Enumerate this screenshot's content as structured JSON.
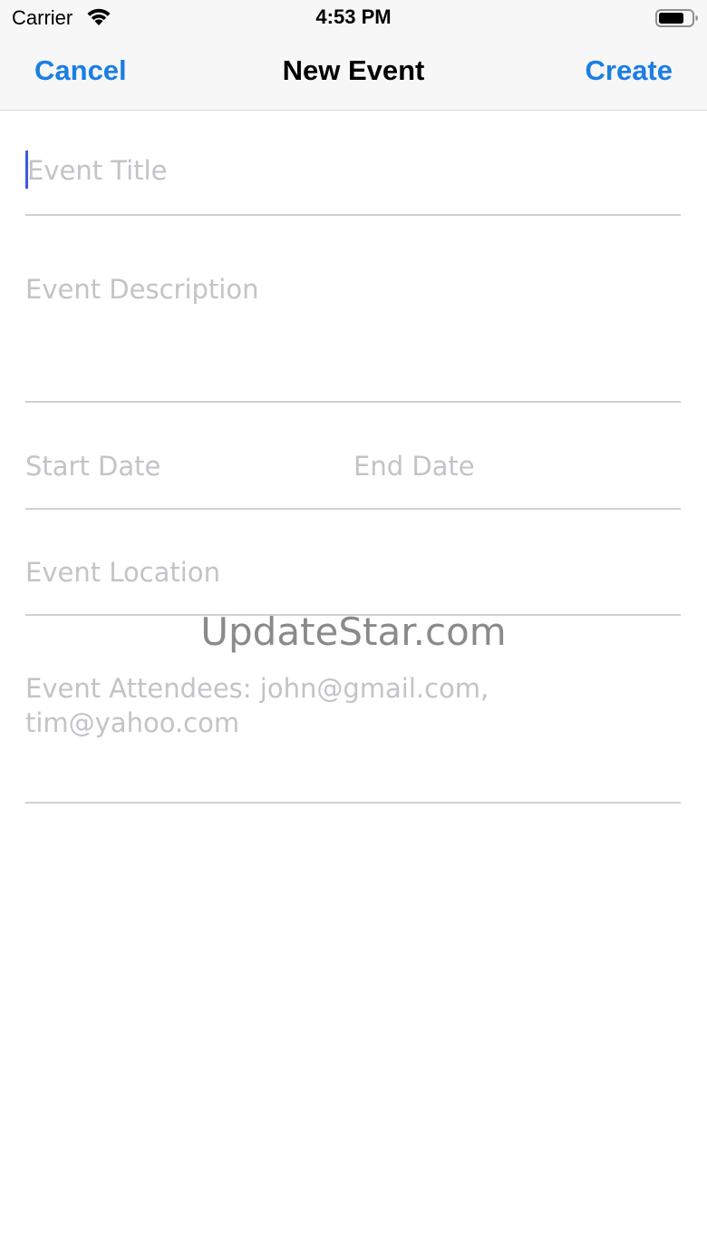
{
  "status_bar": {
    "carrier": "Carrier",
    "time": "4:53 PM",
    "wifi_icon": "wifi-icon",
    "battery_icon": "battery-icon"
  },
  "nav": {
    "cancel_label": "Cancel",
    "title": "New Event",
    "create_label": "Create",
    "accent_color": "#1b7ee3"
  },
  "form": {
    "title_placeholder": "Event Title",
    "title_value": "",
    "description_placeholder": "Event Description",
    "description_value": "",
    "start_date_placeholder": "Start Date",
    "start_date_value": "",
    "end_date_placeholder": "End Date",
    "end_date_value": "",
    "location_placeholder": "Event Location",
    "location_value": "",
    "attendees_placeholder": "Event Attendees: john@gmail.com, tim@yahoo.com",
    "attendees_value": ""
  },
  "watermark": {
    "text": "UpdateStar.com"
  }
}
